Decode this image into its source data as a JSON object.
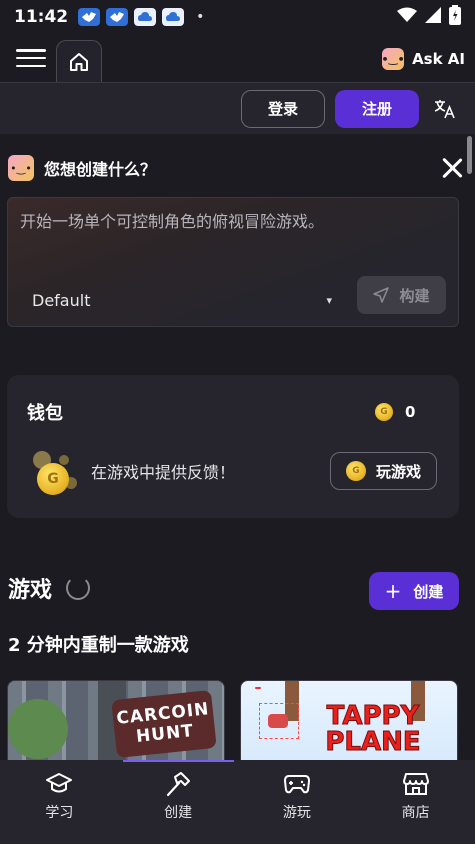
{
  "status_bar": {
    "time": "11:42",
    "dot": "•"
  },
  "topbar": {
    "ask_ai_label": "Ask AI"
  },
  "header": {
    "login_label": "登录",
    "signup_label": "注册"
  },
  "prompt": {
    "title": "您想创建什么？",
    "placeholder": "开始一场单个可控制角色的俯视冒险游戏。",
    "model_value": "Default",
    "build_label": "构建"
  },
  "wallet": {
    "title": "钱包",
    "balance": "0",
    "message": "在游戏中提供反馈！",
    "play_label": "玩游戏"
  },
  "games": {
    "title": "游戏",
    "create_label": "创建",
    "section_subtitle": "2 分钟内重制一款游戏",
    "cards": [
      {
        "logo_line1": "CARCOIN",
        "logo_line2": "HUNT"
      },
      {
        "logo_line1": "TAPPY",
        "logo_line2": "PLANE"
      }
    ]
  },
  "bottom_nav": {
    "items": [
      {
        "label": "学习",
        "icon": "graduation-cap-icon"
      },
      {
        "label": "创建",
        "icon": "hammer-icon"
      },
      {
        "label": "游玩",
        "icon": "gamepad-icon"
      },
      {
        "label": "商店",
        "icon": "store-icon"
      }
    ],
    "active_index": 1
  },
  "colors": {
    "background": "#1c1b22",
    "card": "#26252d",
    "accent": "#5b2fd6",
    "active_indicator": "#7b5cf0"
  }
}
